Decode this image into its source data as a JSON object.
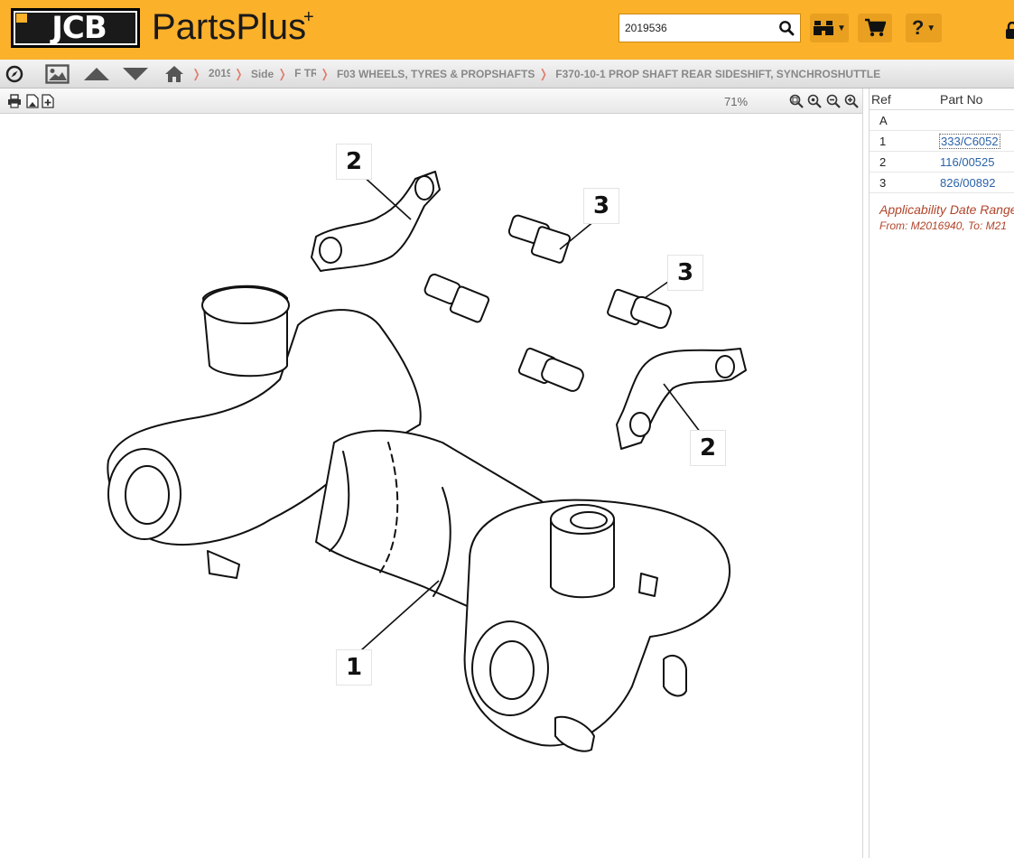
{
  "header": {
    "logo_text": "JCB",
    "app_title": "PartsPlus",
    "app_title_plus": "+",
    "search": {
      "value": "2019536",
      "placeholder": ""
    },
    "buttons": [
      {
        "icon": "binoculars-icon",
        "has_caret": true
      },
      {
        "icon": "cart-icon",
        "has_caret": false
      },
      {
        "icon": "help-icon",
        "label": "?",
        "has_caret": true
      }
    ],
    "accent_color": "#fcb12b"
  },
  "nav": {
    "icons": [
      "compass-icon",
      "image-icon",
      "arrow-up-icon",
      "arrow-down-icon",
      "home-icon"
    ],
    "breadcrumbs": [
      {
        "label": "2019",
        "truncated": true
      },
      {
        "label": "Side",
        "truncated": false
      },
      {
        "label": "F TR",
        "truncated": true
      },
      {
        "label": "F03 WHEELS, TYRES & PROPSHAFTS",
        "truncated": false
      },
      {
        "label": "F370-10-1 PROP SHAFT REAR SIDESHIFT, SYNCHROSHUTTLE",
        "truncated": false
      }
    ]
  },
  "viewer": {
    "toolbar_icons": [
      "print-icon",
      "save-image-icon",
      "add-page-icon",
      "zoom-fit-icon",
      "zoom-reset-icon",
      "zoom-out-icon",
      "zoom-in-icon"
    ],
    "zoom_level": "71%",
    "callouts": [
      "2",
      "3",
      "3",
      "2",
      "1"
    ]
  },
  "parts_table": {
    "columns": [
      "Ref",
      "Part No"
    ],
    "rows": [
      {
        "ref": "A",
        "part_no": ""
      },
      {
        "ref": "1",
        "part_no": "333/C6052",
        "selected": true
      },
      {
        "ref": "2",
        "part_no": "116/00525"
      },
      {
        "ref": "3",
        "part_no": "826/00892"
      }
    ],
    "applicability_title": "Applicability Date Range",
    "applicability_text": "From: M2016940, To: M21"
  }
}
